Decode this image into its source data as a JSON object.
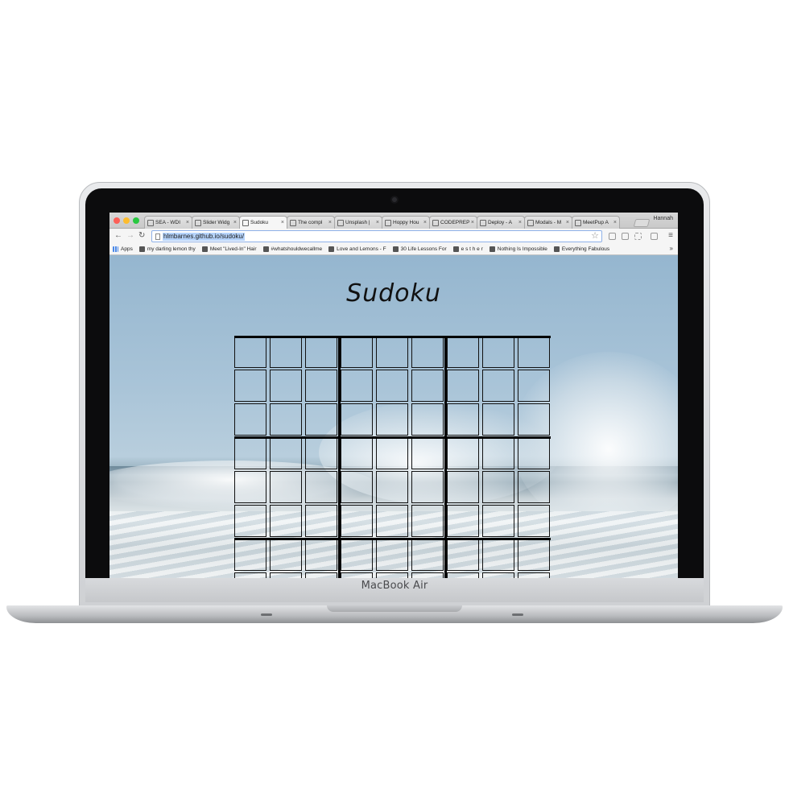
{
  "device": {
    "brand": "MacBook Air"
  },
  "browser": {
    "tabs": [
      {
        "label": "SEA - WDI",
        "icon": "github-icon",
        "active": false
      },
      {
        "label": "Slider Widg",
        "icon": "ustwo-icon",
        "active": false
      },
      {
        "label": "Sudoku",
        "icon": "page-icon",
        "active": true
      },
      {
        "label": "The compl",
        "icon": "u-icon",
        "active": false
      },
      {
        "label": "Unsplash |",
        "icon": "camera-icon",
        "active": false
      },
      {
        "label": "Hoppy Hou",
        "icon": "page-icon",
        "active": false
      },
      {
        "label": "CODEPREP",
        "icon": "page-icon",
        "active": false
      },
      {
        "label": "Deploy - A",
        "icon": "book-icon",
        "active": false
      },
      {
        "label": "Modals - M",
        "icon": "m-icon",
        "active": false
      },
      {
        "label": "MeetPup A",
        "icon": "page-icon",
        "active": false
      }
    ],
    "close_glyph": "×",
    "user_name": "Hannah",
    "url": "hlmbarnes.github.io/sudoku/",
    "bookmarks": [
      {
        "label": "Apps"
      },
      {
        "label": "my darling lemon thy"
      },
      {
        "label": "Meet \"Lived-In\" Hair"
      },
      {
        "label": "#whatshouldwecallme"
      },
      {
        "label": "Love and Lemons - F"
      },
      {
        "label": "30 Life Lessons For"
      },
      {
        "label": "e s t h e r"
      },
      {
        "label": "Nothing Is Impossible"
      },
      {
        "label": "Everything Fabulous"
      }
    ],
    "more_bookmarks_glyph": "»"
  },
  "page": {
    "title": "Sudoku",
    "grid": {
      "rows": 9,
      "cols": 9,
      "cells": [
        "",
        "",
        "",
        "",
        "",
        "",
        "",
        "",
        "",
        "",
        "",
        "",
        "",
        "",
        "",
        "",
        "",
        "",
        "",
        "",
        "",
        "",
        "",
        "",
        "",
        "",
        "",
        "",
        "",
        "",
        "",
        "",
        "",
        "",
        "",
        "",
        "",
        "",
        "",
        "",
        "",
        "",
        "",
        "",
        "",
        "",
        "",
        "",
        "",
        "",
        "",
        "",
        "",
        "",
        "",
        "",
        "",
        "",
        "",
        "",
        "",
        "",
        "",
        "",
        "",
        "",
        "",
        "",
        "",
        "",
        "",
        "",
        "",
        "",
        "",
        "",
        "",
        "",
        "",
        "",
        ""
      ]
    }
  }
}
